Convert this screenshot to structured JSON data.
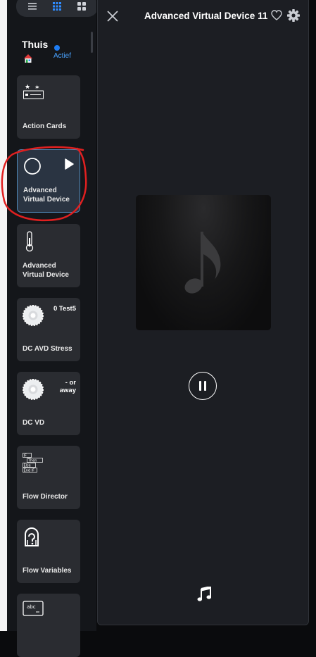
{
  "sidebar": {
    "home": {
      "title": "Thuis",
      "status": "Actief"
    },
    "cards": [
      {
        "label": "Action Cards",
        "value": "",
        "icon": "action-cards-icon"
      },
      {
        "label": "Advanced Virtual Device",
        "value": "",
        "icon": "circle-icon",
        "selected": true
      },
      {
        "label": "Advanced Virtual Device",
        "value": "",
        "icon": "thermometer-icon"
      },
      {
        "label": "DC AVD Stress",
        "value": "0 Test5",
        "icon": "gear-badge-icon"
      },
      {
        "label": "DC VD",
        "value": "- or away",
        "icon": "gear-badge-icon"
      },
      {
        "label": "Flow Director",
        "value": "",
        "icon": "flow-director-icon"
      },
      {
        "label": "Flow Variables",
        "value": "",
        "icon": "flow-variables-icon"
      },
      {
        "label": "",
        "value": "",
        "icon": "abc-icon"
      }
    ],
    "flow_director_icon_lines": [
      "IF",
      "Then",
      "Else",
      "End IF"
    ],
    "abc_icon_text": "abc"
  },
  "panel": {
    "title": "Advanced Virtual Device 11"
  },
  "colors": {
    "accent": "#1e7cf2",
    "annotation": "#e02020",
    "panel_bg": "#1c1e23",
    "card_bg": "#2a2c31"
  }
}
